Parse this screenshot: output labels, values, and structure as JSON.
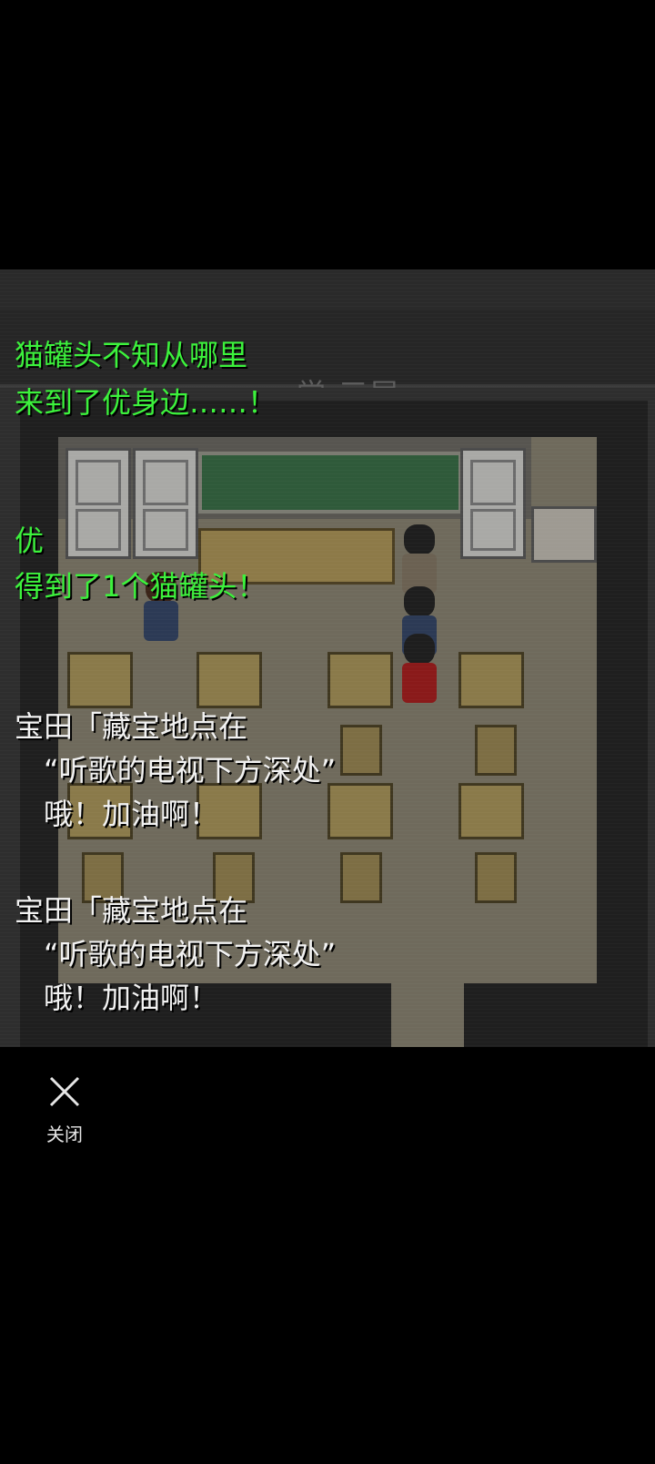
{
  "game": {
    "location": "学 三层"
  },
  "messages": [
    {
      "lines": [
        "猫罐头不知从哪里",
        "来到了优身边……！"
      ],
      "color": "green"
    },
    {
      "lines": [
        "优",
        "得到了1个猫罐头！"
      ],
      "color": "green"
    },
    {
      "lines": [
        "宝田「藏宝地点在",
        "　“听歌的电视下方深处”",
        "　哦！加油啊！"
      ],
      "color": "white"
    },
    {
      "lines": [
        "宝田「藏宝地点在",
        "　“听歌的电视下方深处”",
        "　哦！加油啊！"
      ],
      "color": "white"
    }
  ],
  "close_button": {
    "label": "关闭",
    "icon": "close-icon"
  },
  "colors": {
    "system_text": "#3cf23c",
    "dialog_text": "#f2f2f2",
    "background": "#000000"
  }
}
